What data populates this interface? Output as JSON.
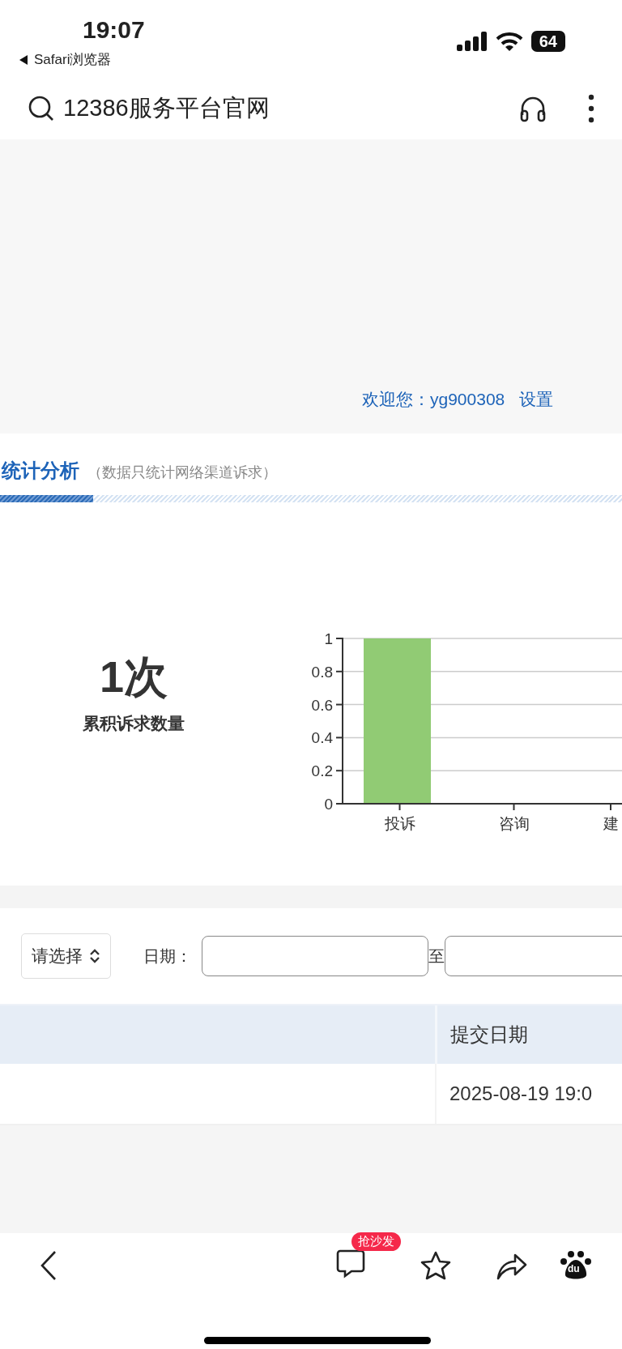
{
  "status_bar": {
    "time": "19:07",
    "back_app": "Safari浏览器",
    "battery": "64"
  },
  "address_bar": {
    "query": "12386服务平台官网"
  },
  "header": {
    "welcome": "欢迎您：yg900308",
    "settings_link": "设置"
  },
  "stats": {
    "title": "统计分析",
    "note": "（数据只统计网络渠道诉求）",
    "total": "1次",
    "total_label": "累积诉求数量",
    "chart_data": {
      "type": "bar",
      "categories": [
        "投诉",
        "咨询",
        "建"
      ],
      "series": [
        {
          "color": "#91cb74",
          "values": [
            1,
            0,
            0
          ]
        }
      ],
      "grid": true,
      "ylim": [
        0,
        1
      ],
      "yticks": [
        0,
        0.2,
        0.4,
        0.6,
        0.8,
        1
      ]
    }
  },
  "filters": {
    "select": "请选择",
    "date_label": "日期：",
    "range_separator": "至"
  },
  "table": {
    "columns": [
      "提交日期"
    ],
    "rows": [
      [
        "2025-08-19 19:0"
      ]
    ]
  },
  "bottom_bar": {
    "comment_badge": "抢沙发",
    "logo_text": "du"
  }
}
